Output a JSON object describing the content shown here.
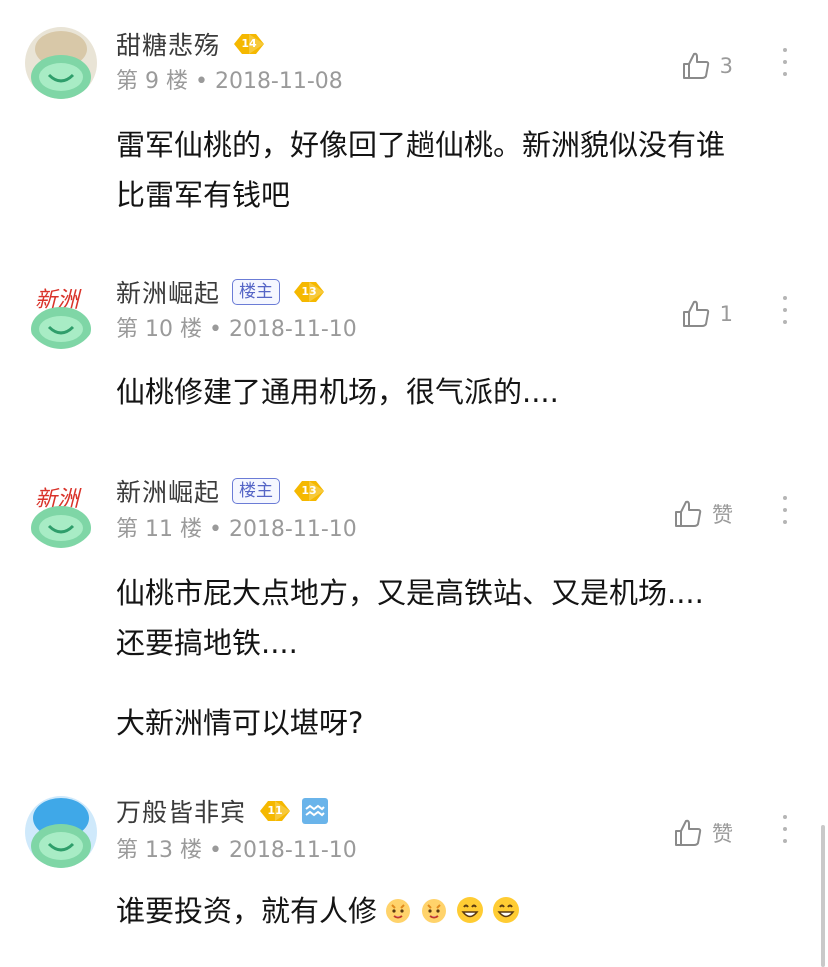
{
  "posts": [
    {
      "username": "甜糖悲殇",
      "level": "14",
      "floor_meta": "第 9 楼 • 2018-11-08",
      "likes": "3",
      "content": [
        "雷军仙桃的，好像回了趟仙桃。新洲貌似没有谁",
        "比雷军有钱吧"
      ]
    },
    {
      "username": "新洲崛起",
      "owner_badge": "楼主",
      "level": "13",
      "floor_meta": "第 10 楼 • 2018-11-10",
      "likes": "1",
      "content": [
        "仙桃修建了通用机场，很气派的...."
      ]
    },
    {
      "username": "新洲崛起",
      "owner_badge": "楼主",
      "level": "13",
      "floor_meta": "第 11 楼 • 2018-11-10",
      "likes": "赞",
      "content": [
        "仙桃市屁大点地方，又是高铁站、又是机场....",
        "还要搞地铁....",
        "大新洲情可以堪呀?"
      ]
    },
    {
      "username": "万般皆非宾",
      "level": "11",
      "floor_meta": "第 13 楼 • 2018-11-10",
      "likes": "赞",
      "content": [
        "谁要投资，就有人修"
      ]
    }
  ],
  "colors": {
    "badge_gold": "#f5b800",
    "owner_blue": "#5565c6",
    "meta_gray": "#9a9a9a"
  }
}
